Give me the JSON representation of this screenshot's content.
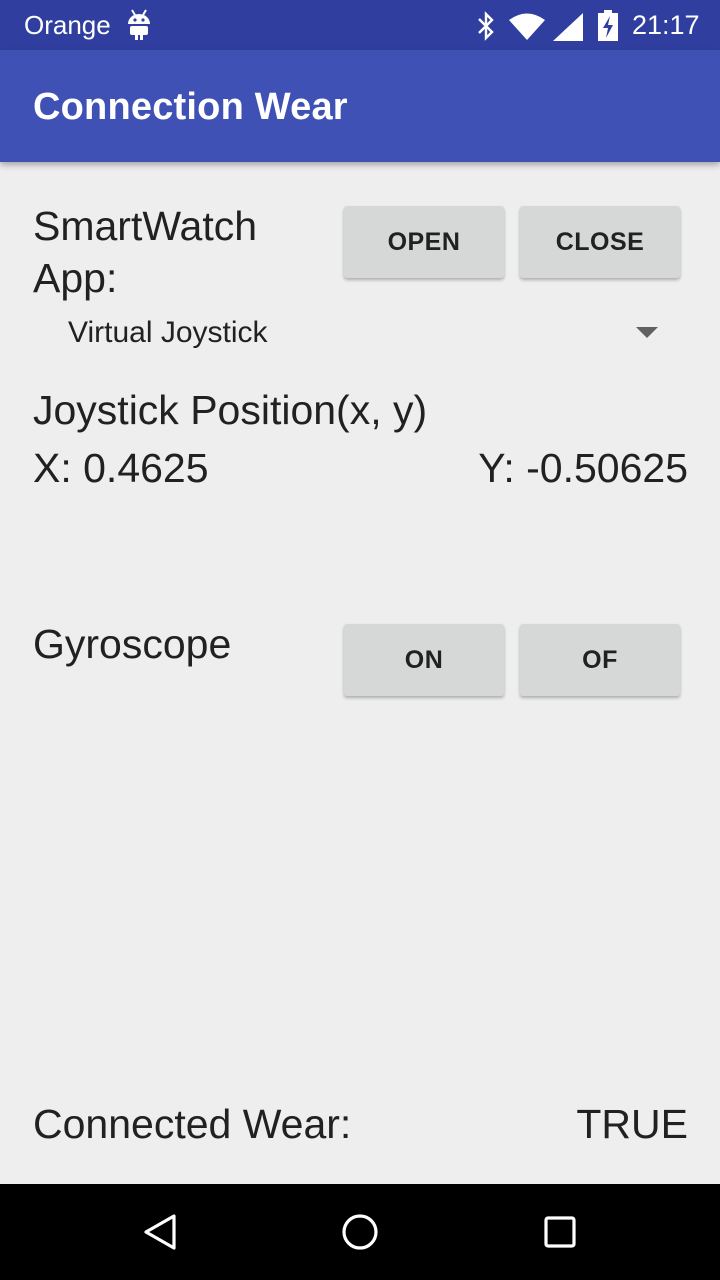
{
  "status_bar": {
    "carrier": "Orange",
    "time": "21:17",
    "icons": [
      "android-icon",
      "bluetooth-icon",
      "wifi-icon",
      "cell-signal-icon",
      "battery-charging-icon"
    ]
  },
  "app_bar": {
    "title": "Connection Wear"
  },
  "smartwatch": {
    "label_line1": "SmartWatch",
    "label_line2": "App:",
    "open_label": "OPEN",
    "close_label": "CLOSE",
    "selected_app": "Virtual Joystick"
  },
  "joystick": {
    "heading": "Joystick Position(x, y)",
    "x_text": "X: 0.4625",
    "y_text": "Y: -0.50625"
  },
  "gyroscope": {
    "label": "Gyroscope",
    "on_label": "ON",
    "off_label": "OF"
  },
  "connection": {
    "label": "Connected Wear:",
    "value": "TRUE"
  },
  "nav_bar": {
    "icons": [
      "back-icon",
      "home-icon",
      "recents-icon"
    ]
  },
  "colors": {
    "status_bar": "#303f9f",
    "app_bar": "#3f51b5",
    "background": "#eeeeee",
    "button": "#d6d7d7",
    "text": "#212121"
  }
}
